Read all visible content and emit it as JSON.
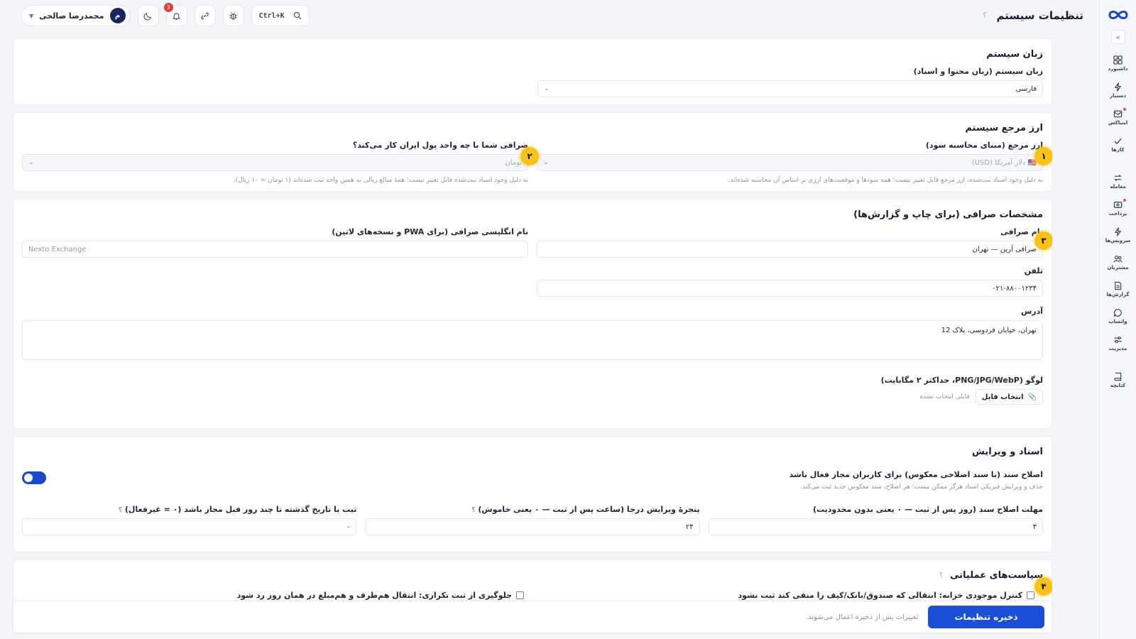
{
  "header": {
    "title": "تنظیمات سیستم",
    "help": "؟",
    "search_shortcut": "Ctrl+K",
    "notifications_count": "3",
    "user_name": "محمدرضا صالحی",
    "user_initial": "م"
  },
  "sidebar": {
    "items": [
      {
        "label": "داشبورد",
        "icon": "grid-icon"
      },
      {
        "label": "دستیار",
        "icon": "bolt-icon"
      },
      {
        "label": "اینباکس",
        "icon": "inbox-icon"
      },
      {
        "label": "کارها",
        "icon": "check-icon"
      },
      {
        "label": "معامله",
        "icon": "swap-icon"
      },
      {
        "label": "پرداخت",
        "icon": "payment-icon"
      },
      {
        "label": "سرویس‌ها",
        "icon": "bolt-icon"
      },
      {
        "label": "مشتریان",
        "icon": "users-icon"
      },
      {
        "label": "گزارش‌ها",
        "icon": "report-icon"
      },
      {
        "label": "واتساپ",
        "icon": "chat-icon"
      },
      {
        "label": "مدیریت",
        "icon": "sliders-icon"
      },
      {
        "label": "کتابچه",
        "icon": "book-icon"
      }
    ]
  },
  "language_section": {
    "title": "زبان سیستم",
    "field_label": "زبان سیستم (زبان محتوا و اسناد)",
    "value": "فارسی"
  },
  "currency_section": {
    "title": "ارز مرجع سیستم",
    "ref_label": "ارز مرجع (مبنای محاسبه سود)",
    "ref_value": "دلار آمریکا (USD)",
    "ref_hint": "به دلیل وجود اسناد ثبت‌شده، ارز مرجع قابل تغییر نیست؛ همه سودها و موقعیت‌های ارزی بر اساس آن محاسبه شده‌اند.",
    "iran_label": "صرافی شما با چه واحد پول ایران کار می‌کند؟",
    "iran_value": "تومان",
    "iran_hint": "به دلیل وجود اسناد ثبت‌شده قابل تغییر نیست؛ همهٔ مبالغ ریالی به همین واحد ثبت شده‌اند (۱ تومان = ۱۰ ریال).",
    "step1": "۱",
    "step2": "۲"
  },
  "exchange_section": {
    "title": "مشخصات صرافی (برای چاپ و گزارش‌ها)",
    "name_label": "نام صرافی",
    "name_value": "صرافی آرین — تهران",
    "en_name_label": "نام انگلیسی صرافی (برای PWA و نسخه‌های لاتین)",
    "en_name_placeholder": "Nexto Exchange",
    "phone_label": "تلفن",
    "phone_value": "۰۲۱-۸۸۰۰۱۲۳۴",
    "address_label": "آدرس",
    "address_value": "تهران، خیابان فردوسی، پلاک 12",
    "logo_label": "لوگو (PNG/JPG/WebP، حداکثر ۲ مگابایت)",
    "file_button": "انتخاب فایل",
    "file_status": "فایلی انتخاب نشده",
    "step3": "۳"
  },
  "documents_section": {
    "title": "اسناد و ویرایش",
    "correction_label": "اصلاح سند (با سند اصلاحی معکوس) برای کاربران مجاز فعال باشد",
    "correction_hint": "حذف و ویرایش فیزیکی اسناد هرگز ممکن نیست؛ هر اصلاح، سند معکوس جدید ثبت می‌کند.",
    "toggle_on": true,
    "deadline_label": "مهلت اصلاح سند (روز پس از ثبت — ۰ یعنی بدون محدودیت)",
    "deadline_value": "۳",
    "window_label": "پنجرهٔ ویرایش درجا (ساعت پس از ثبت — ۰ یعنی خاموش)",
    "window_value": "۲۴",
    "backdate_label": "ثبت با تاریخ گذشته تا چند روز قبل مجاز باشد (۰ = غیرفعال)",
    "backdate_value": "۰",
    "help": "؟"
  },
  "ops_section": {
    "title": "سیاست‌های عملیاتی",
    "help": "؟",
    "treasury_label": "کنترل موجودی خزانه: انتقالی که صندوق/بانک/کیف را منفی کند ثبت نشود",
    "duplicate_label": "جلوگیری از ثبت تکراری: انتقال هم‌طرف و هم‌مبلغ در همان روز رد شود",
    "step4": "۴"
  },
  "footer": {
    "save_label": "ذخیره تنظیمات",
    "note": "تغییرات پس از ذخیره اعمال می‌شوند."
  },
  "colors": {
    "accent": "#1a4fd6",
    "step_badge": "#f9c21b",
    "avatar": "#17265f"
  }
}
